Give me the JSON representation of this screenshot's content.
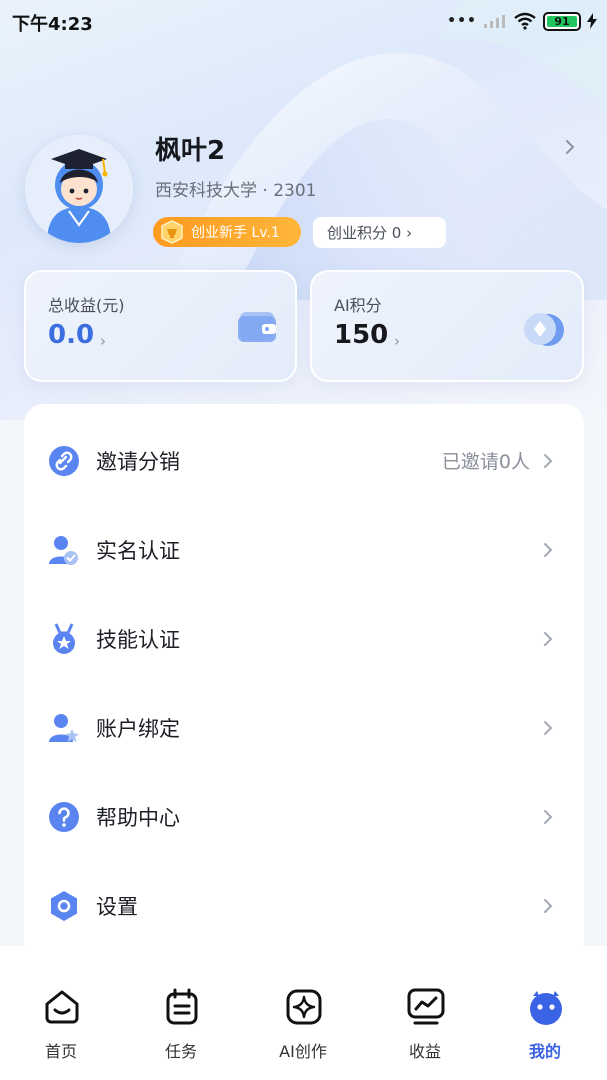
{
  "status_bar": {
    "time": "下午4:23",
    "battery": "91"
  },
  "profile": {
    "name": "枫叶2",
    "subtitle": "西安科技大学 · 2301",
    "level_badge": "创业新手 Lv.1",
    "points_badge": "创业积分 0 ›"
  },
  "stats": [
    {
      "label": "总收益(元)",
      "value": "0.0",
      "arrow": "›"
    },
    {
      "label": "AI积分",
      "value": "150",
      "arrow": "›"
    }
  ],
  "menu": [
    {
      "label": "邀请分销",
      "right": "已邀请0人",
      "icon": "link-icon"
    },
    {
      "label": "实名认证",
      "right": "",
      "icon": "user-verified-icon"
    },
    {
      "label": "技能认证",
      "right": "",
      "icon": "medal-icon"
    },
    {
      "label": "账户绑定",
      "right": "",
      "icon": "user-star-icon"
    },
    {
      "label": "帮助中心",
      "right": "",
      "icon": "help-icon"
    },
    {
      "label": "设置",
      "right": "",
      "icon": "settings-icon"
    }
  ],
  "bottom_nav": [
    {
      "label": "首页",
      "icon": "home-icon",
      "active": false
    },
    {
      "label": "任务",
      "icon": "task-icon",
      "active": false
    },
    {
      "label": "AI创作",
      "icon": "ai-create-icon",
      "active": false
    },
    {
      "label": "收益",
      "icon": "earnings-icon",
      "active": false
    },
    {
      "label": "我的",
      "icon": "mine-icon",
      "active": true
    }
  ],
  "colors": {
    "accent": "#3b63e6",
    "badge_orange": "#ff9a1f",
    "battery_green": "#22c55e"
  }
}
